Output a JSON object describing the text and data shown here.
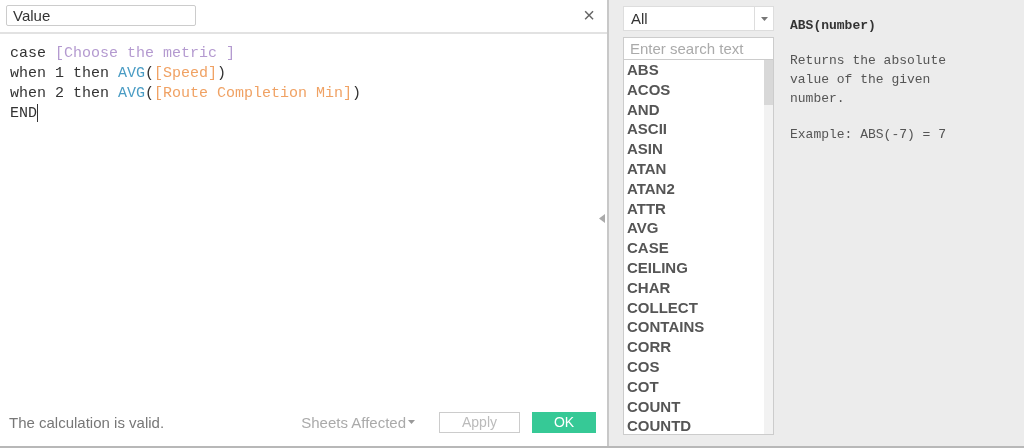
{
  "calc_name": "Value",
  "close_glyph": "×",
  "code_lines": [
    [
      {
        "text": "case ",
        "kind": "keyword"
      },
      {
        "text": "[Choose the metric ]",
        "kind": "parameter"
      }
    ],
    [
      {
        "text": "when 1 then ",
        "kind": "keyword"
      },
      {
        "text": "AVG",
        "kind": "function"
      },
      {
        "text": "(",
        "kind": "keyword"
      },
      {
        "text": "[Speed]",
        "kind": "field"
      },
      {
        "text": ")",
        "kind": "keyword"
      }
    ],
    [
      {
        "text": "when 2 then ",
        "kind": "keyword"
      },
      {
        "text": "AVG",
        "kind": "function"
      },
      {
        "text": "(",
        "kind": "keyword"
      },
      {
        "text": "[Route Completion Min]",
        "kind": "field"
      },
      {
        "text": ")",
        "kind": "keyword"
      }
    ],
    [
      {
        "text": "END",
        "kind": "keyword"
      }
    ]
  ],
  "status": "The calculation is valid.",
  "sheets_affected": "Sheets Affected",
  "buttons": [
    {
      "label": "Apply",
      "kind": "secondary",
      "disabled": true
    },
    {
      "label": "OK",
      "kind": "primary",
      "disabled": false
    }
  ],
  "category_dropdown": {
    "value": "All"
  },
  "search": {
    "placeholder": "Enter search text"
  },
  "functions": [
    "ABS",
    "ACOS",
    "AND",
    "ASCII",
    "ASIN",
    "ATAN",
    "ATAN2",
    "ATTR",
    "AVG",
    "CASE",
    "CEILING",
    "CHAR",
    "COLLECT",
    "CONTAINS",
    "CORR",
    "COS",
    "COT",
    "COUNT",
    "COUNTD"
  ],
  "help": {
    "signature": "ABS(number)",
    "description": "Returns the absolute value of the given number.",
    "example": "Example: ABS(-7) = 7"
  }
}
